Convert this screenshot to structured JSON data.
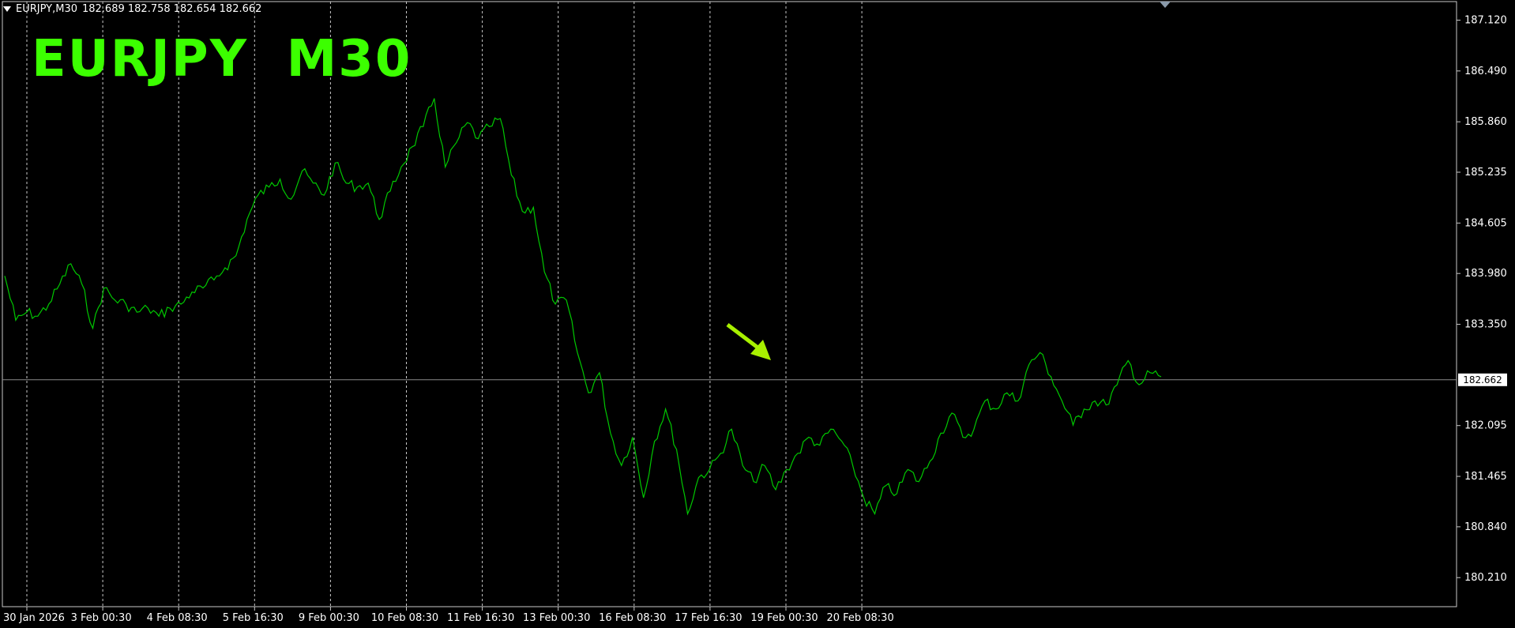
{
  "header": {
    "symbol_label": "EURJPY,M30",
    "ohlc": "182.689 182.758 182.654 182.662"
  },
  "watermark": "EURJPY  M30",
  "colors": {
    "background": "#000000",
    "line": "#00c800",
    "grid": "#c8c8c8",
    "watermark": "#3cff00",
    "arrow": "#a8f000",
    "price_line": "#8a8a8a"
  },
  "icons": {
    "menu": "triangle-down-icon",
    "annotation": "arrow-icon"
  },
  "chart_data": {
    "type": "line",
    "symbol": "EURJPY",
    "timeframe": "M30",
    "current_price": 182.662,
    "current_price_label": "182.662",
    "ylim": [
      179.85,
      187.35
    ],
    "y_ticks": [
      "187.120",
      "186.490",
      "185.860",
      "185.235",
      "184.605",
      "183.980",
      "183.350",
      "182.095",
      "181.465",
      "180.840",
      "180.210"
    ],
    "x_ticks": [
      "30 Jan 2026",
      "3 Feb 00:30",
      "4 Feb 08:30",
      "5 Feb 16:30",
      "9 Feb 00:30",
      "10 Feb 08:30",
      "11 Feb 16:30",
      "13 Feb 00:30",
      "16 Feb 08:30",
      "17 Feb 16:30",
      "19 Feb 00:30",
      "20 Feb 08:30"
    ],
    "grid": "vertical dashed at each x tick",
    "series": [
      {
        "values": [
          183.95,
          183.4,
          183.5,
          183.45,
          183.6,
          183.85,
          184.1,
          183.85,
          183.3,
          183.8,
          183.65,
          183.6,
          183.5,
          183.55,
          183.45,
          183.55,
          183.6,
          183.75,
          183.8,
          183.9,
          184.05,
          184.2,
          184.65,
          184.95,
          185.05,
          185.15,
          184.9,
          185.25,
          185.1,
          184.95,
          185.35,
          185.1,
          185.05,
          185.1,
          184.65,
          185.0,
          185.3,
          185.55,
          185.8,
          186.15,
          185.3,
          185.6,
          185.85,
          185.65,
          185.8,
          185.9,
          185.2,
          184.75,
          184.8,
          184.0,
          183.6,
          183.65,
          183.0,
          182.5,
          182.75,
          182.0,
          181.6,
          181.95,
          181.2,
          181.9,
          182.3,
          181.8,
          181.0,
          181.45,
          181.55,
          181.75,
          182.05,
          181.6,
          181.4,
          181.6,
          181.3,
          181.55,
          181.75,
          181.95,
          181.85,
          182.05,
          181.9,
          181.6,
          181.2,
          181.0,
          181.35,
          181.25,
          181.55,
          181.4,
          181.65,
          182.0,
          182.25,
          181.95,
          182.05,
          182.4,
          182.3,
          182.5,
          182.4,
          182.85,
          183.0,
          182.7,
          182.4,
          182.1,
          182.3,
          182.4,
          182.35,
          182.6,
          182.9,
          182.6,
          182.75,
          182.7
        ]
      }
    ]
  }
}
